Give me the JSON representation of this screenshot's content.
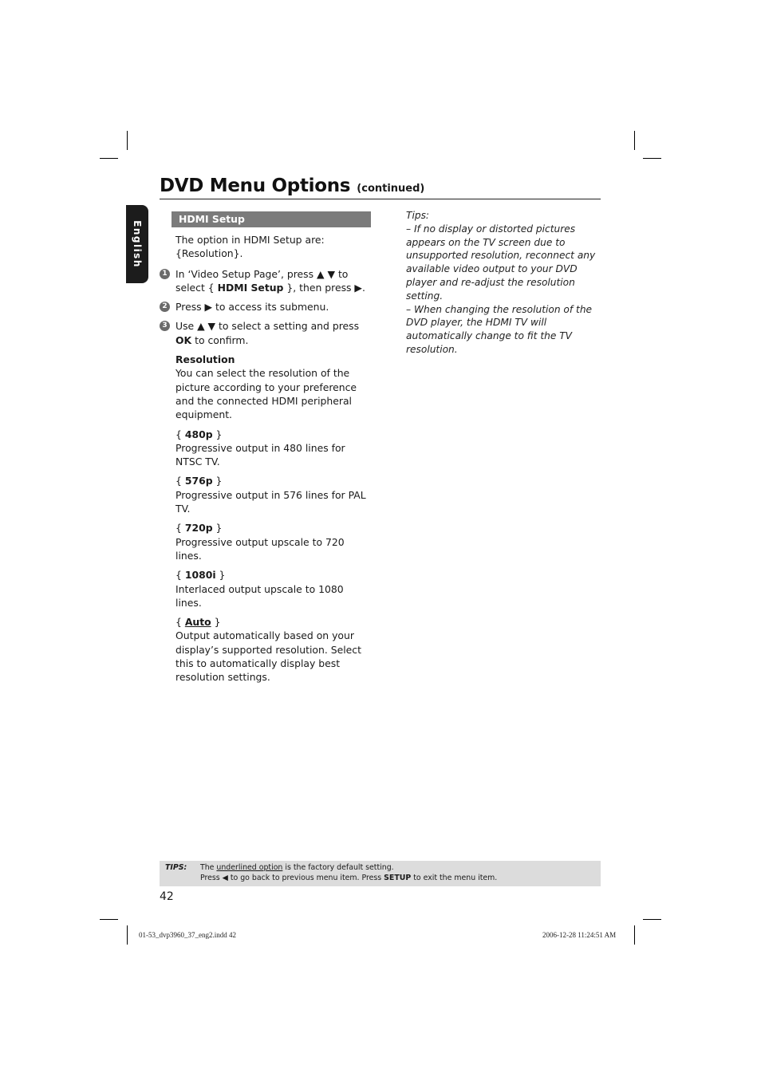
{
  "header": {
    "title": "DVD Menu Options",
    "continued": "(continued)"
  },
  "side_tab": {
    "label": "English"
  },
  "left_column": {
    "section_title": "HDMI Setup",
    "intro": "The option in HDMI Setup are: {Resolution}.",
    "steps": [
      {
        "num": "1",
        "pre": "In ‘Video Setup Page’, press ▲ ▼ to select { ",
        "bold": "HDMI Setup",
        "post": " }, then press ▶."
      },
      {
        "num": "2",
        "pre": "Press ▶ to access its submenu.",
        "bold": "",
        "post": ""
      },
      {
        "num": "3",
        "pre": "Use ▲ ▼ to select a setting and press ",
        "bold": "OK",
        "post": " to confirm."
      }
    ],
    "resolution": {
      "heading": "Resolution",
      "description": "You can select the resolution of the picture according to your preference and the connected HDMI peripheral equipment."
    },
    "options": [
      {
        "label": "480p",
        "default": false,
        "description": "Progressive output in 480 lines for NTSC TV."
      },
      {
        "label": "576p",
        "default": false,
        "description": "Progressive output in 576 lines for PAL TV."
      },
      {
        "label": "720p",
        "default": false,
        "description": "Progressive output upscale to 720 lines."
      },
      {
        "label": "1080i",
        "default": false,
        "description": "Interlaced output upscale to 1080 lines."
      },
      {
        "label": "Auto",
        "default": true,
        "description": "Output automatically based on your display’s supported resolution. Select this to automatically display best resolution settings."
      }
    ]
  },
  "right_column": {
    "heading": "Tips:",
    "tips": [
      "– If no display or distorted pictures appears on the TV screen due to unsupported resolution, reconnect any available video output to your DVD player and re-adjust the resolution setting.",
      "– When changing the resolution of the DVD player, the HDMI TV will automatically change to fit the TV resolution."
    ]
  },
  "footer_tips": {
    "label": "TIPS:",
    "line1_pre": "The ",
    "line1_underlined": "underlined option",
    "line1_post": " is the factory default setting.",
    "line2_pre": "Press ◀ to go back to previous menu item. Press ",
    "line2_bold": "SETUP",
    "line2_post": " to exit the menu item."
  },
  "page_number": "42",
  "slug": {
    "file": "01-53_dvp3960_37_eng2.indd   42",
    "timestamp": "2006-12-28   11:24:51 AM"
  },
  "colors": {
    "section_bar": "#7b7b7b",
    "side_tab": "#1c1c1c",
    "tips_box": "#dcdcdc"
  }
}
